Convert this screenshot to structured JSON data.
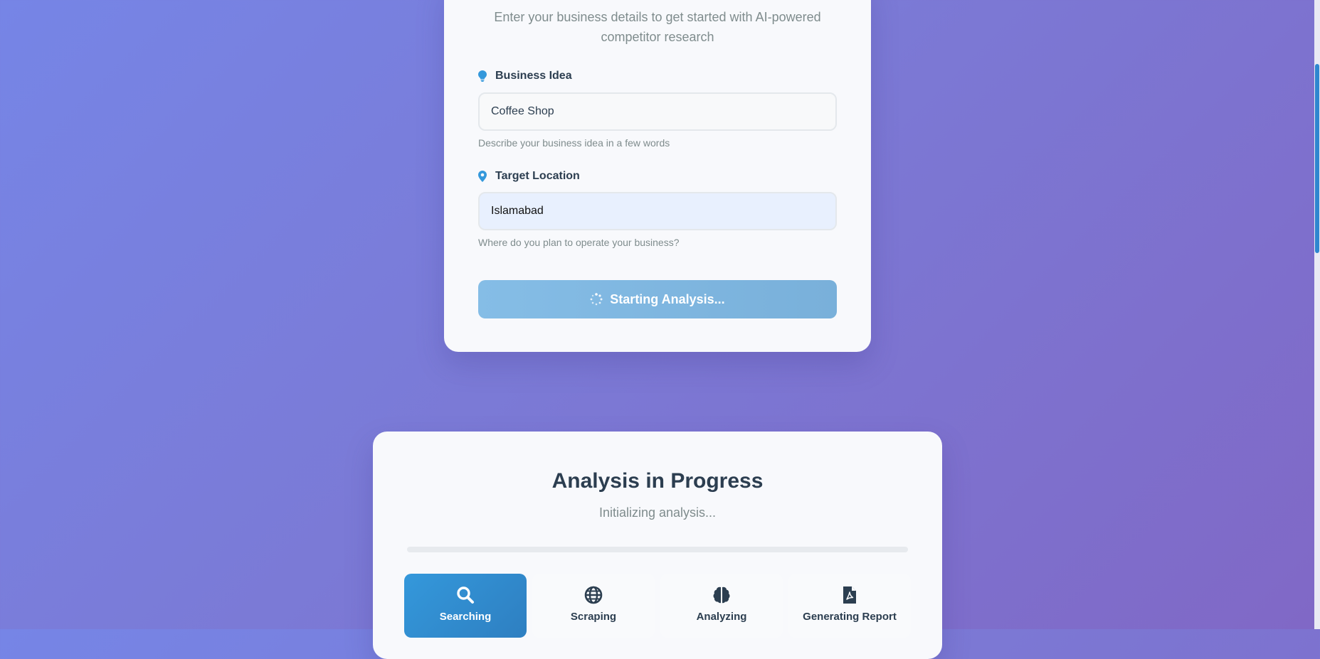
{
  "form": {
    "subtitle": "Enter your business details to get started with AI-powered competitor research",
    "business_idea": {
      "label": "Business Idea",
      "icon": "lightbulb-icon",
      "value": "Coffee Shop",
      "help": "Describe your business idea in a few words"
    },
    "target_location": {
      "label": "Target Location",
      "icon": "map-marker-icon",
      "value": "Islamabad",
      "help": "Where do you plan to operate your business?"
    },
    "submit_label": "Starting Analysis..."
  },
  "progress": {
    "title": "Analysis in Progress",
    "status": "Initializing analysis...",
    "percent": 0,
    "steps": [
      {
        "label": "Searching",
        "icon": "search-icon",
        "active": true
      },
      {
        "label": "Scraping",
        "icon": "globe-icon",
        "active": false
      },
      {
        "label": "Analyzing",
        "icon": "brain-icon",
        "active": false
      },
      {
        "label": "Generating Report",
        "icon": "file-pdf-icon",
        "active": false
      }
    ]
  },
  "colors": {
    "accent": "#3498db",
    "text": "#2c3e50",
    "muted": "#7f8c8d",
    "button_disabled": "#85bde6"
  }
}
